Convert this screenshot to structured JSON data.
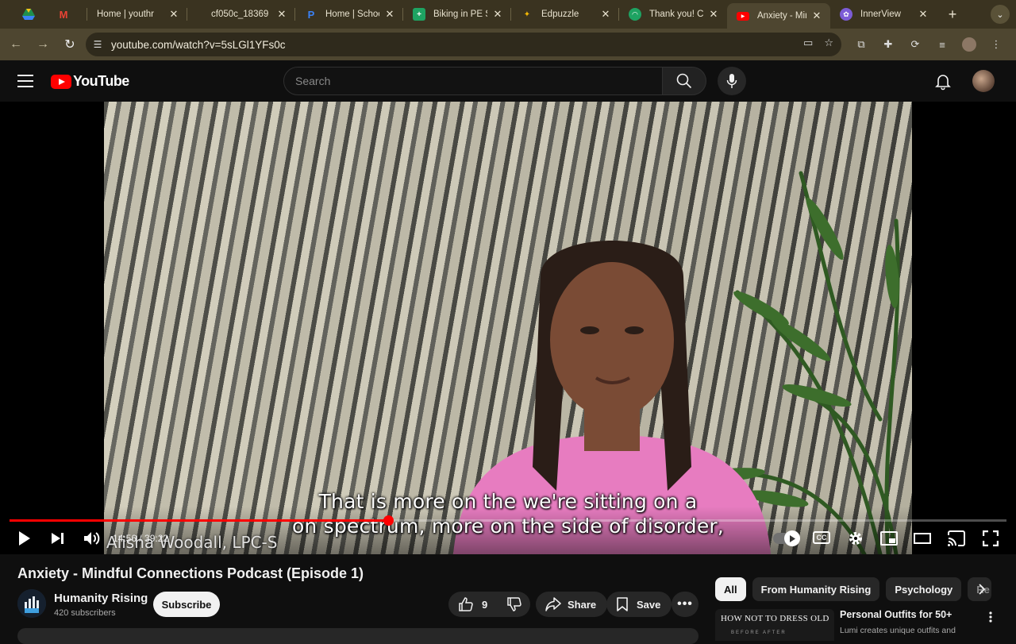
{
  "browser": {
    "tabs": [
      {
        "title": "",
        "icon": "google-drive-icon",
        "active": false
      },
      {
        "title": "",
        "icon": "gmail-icon",
        "active": false
      },
      {
        "title": "Home | youthr",
        "icon": "",
        "active": false
      },
      {
        "title": "cf050c_18369",
        "icon": "",
        "active": false
      },
      {
        "title": "Home | School",
        "icon": "p-icon",
        "active": false
      },
      {
        "title": "Biking in PE SI",
        "icon": "sheets-icon",
        "active": false
      },
      {
        "title": "Edpuzzle",
        "icon": "edpuzzle-icon",
        "active": false
      },
      {
        "title": "Thank you! Cr",
        "icon": "green-circle-icon",
        "active": false
      },
      {
        "title": "Anxiety - Mind",
        "icon": "youtube-icon",
        "active": true
      },
      {
        "title": "InnerView",
        "icon": "innerview-icon",
        "active": false
      }
    ],
    "url": "youtube.com/watch?v=5sLGl1YFs0c"
  },
  "youtube": {
    "logo_text": "YouTube",
    "search_placeholder": "Search"
  },
  "video": {
    "subtitle_line1": "That is more on the we're sitting on a",
    "subtitle_line2": "on spectrum, more on the side of disorder,",
    "lower_third": "Alisha Woodall, LPC-S",
    "time": "14:56 / 39:22",
    "progress_fraction": 0.38
  },
  "meta": {
    "title": "Anxiety - Mindful Connections Podcast (Episode 1)",
    "channel": "Humanity Rising",
    "subscribers": "420 subscribers",
    "subscribe_label": "Subscribe",
    "like_count": "9",
    "share_label": "Share",
    "save_label": "Save"
  },
  "chips": [
    "All",
    "From Humanity Rising",
    "Psychology",
    "Re"
  ],
  "recommendation": {
    "thumb_text": "HOW NOT TO DRESS OLD",
    "thumb_sub": "BEFORE   AFTER",
    "title": "Personal Outfits for 50+",
    "desc": "Lumi creates unique outfits and"
  },
  "colors": {
    "accent": "#ff0000",
    "background": "#0f0f0f",
    "chrome_frame": "#4e4630"
  }
}
